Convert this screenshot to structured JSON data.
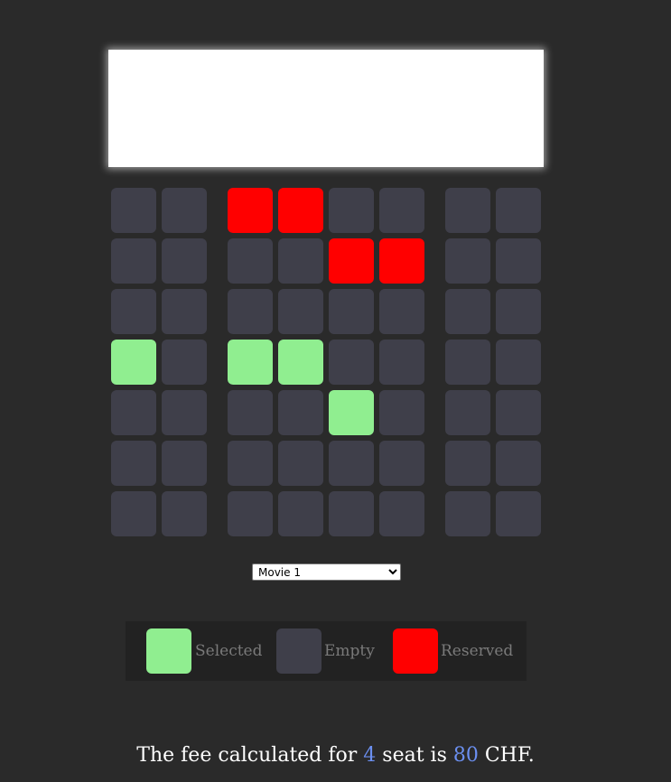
{
  "movie_select": {
    "selected": "Movie 1"
  },
  "seats": {
    "rows": [
      [
        "empty",
        "empty",
        "reserved",
        "reserved",
        "empty",
        "empty",
        "empty",
        "empty"
      ],
      [
        "empty",
        "empty",
        "empty",
        "empty",
        "reserved",
        "reserved",
        "empty",
        "empty"
      ],
      [
        "empty",
        "empty",
        "empty",
        "empty",
        "empty",
        "empty",
        "empty",
        "empty"
      ],
      [
        "selected",
        "empty",
        "selected",
        "selected",
        "empty",
        "empty",
        "empty",
        "empty"
      ],
      [
        "empty",
        "empty",
        "empty",
        "empty",
        "selected",
        "empty",
        "empty",
        "empty"
      ],
      [
        "empty",
        "empty",
        "empty",
        "empty",
        "empty",
        "empty",
        "empty",
        "empty"
      ],
      [
        "empty",
        "empty",
        "empty",
        "empty",
        "empty",
        "empty",
        "empty",
        "empty"
      ]
    ]
  },
  "legend": {
    "selected_label": "Selected",
    "empty_label": "Empty",
    "reserved_label": "Reserved"
  },
  "colors": {
    "background": "#2a2a2a",
    "seat_empty": "#3f3f4a",
    "seat_selected": "#90ee90",
    "seat_reserved": "#ff0000",
    "highlight_number": "#6b8ff0"
  },
  "summary": {
    "prefix": "The fee calculated for ",
    "seat_count": "4",
    "middle": " seat is ",
    "fee": "80",
    "suffix": " CHF."
  }
}
